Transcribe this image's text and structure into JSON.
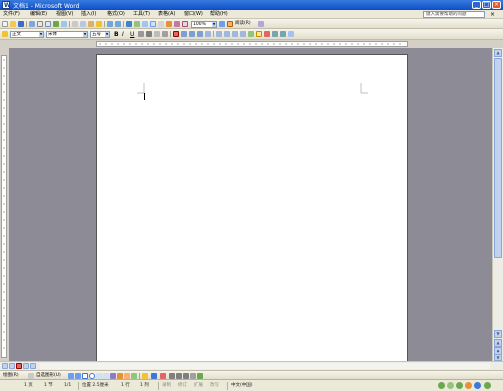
{
  "window": {
    "title": "文档1 - Microsoft Word",
    "app_icon_letter": "W"
  },
  "menu": {
    "items": [
      "文件(F)",
      "编辑(E)",
      "视图(V)",
      "插入(I)",
      "格式(O)",
      "工具(T)",
      "表格(A)",
      "窗口(W)",
      "帮助(H)"
    ],
    "help_search_placeholder": "键入需要帮助的问题"
  },
  "standard_toolbar": {
    "zoom": "100%",
    "read_button": "阅读(R)"
  },
  "format_toolbar": {
    "style": "正文",
    "font": "宋体",
    "size": "五号",
    "bold": "B",
    "italic": "I",
    "underline": "U"
  },
  "drawing_toolbar": {
    "draw_label": "绘图(R)",
    "autoshapes_label": "自选图形(U)"
  },
  "status": {
    "page": "1 页",
    "section": "1 节",
    "page_of": "1/1",
    "position": "位置 2.5厘米",
    "line": "1 行",
    "column": "1 列",
    "modes": [
      "录制",
      "修订",
      "扩展",
      "改写"
    ],
    "language": "中文(中国)"
  },
  "colors": {
    "titlebar": "#0a4fc9",
    "workarea": "#8d8c96",
    "page": "#ffffff"
  }
}
